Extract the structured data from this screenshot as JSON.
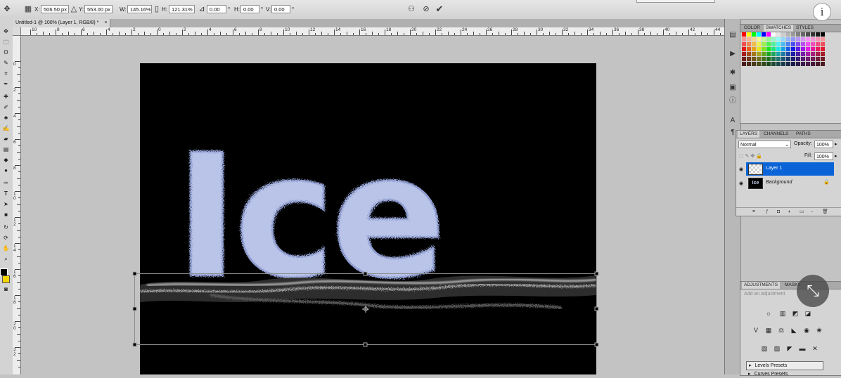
{
  "options_bar": {
    "x_label": "X:",
    "x_value": "506.50 px",
    "y_label": "Y:",
    "y_value": "553.00 px",
    "w_label": "W:",
    "w_value": "145.16%",
    "h_label": "H:",
    "h_value": "121.31%",
    "angle_value": "0.00",
    "hskew_label": "H:",
    "hskew_value": "0.00",
    "vskew_label": "V:",
    "vskew_value": "0.00",
    "degree_symbol": "°"
  },
  "document_tab": {
    "title": "Untitled-1 @ 100% (Layer 1, RGB/8) *",
    "close": "×"
  },
  "rulers": {
    "h_labels": [
      "10",
      "8",
      "6",
      "4",
      "2",
      "0",
      "2",
      "4",
      "6",
      "8",
      "10",
      "12",
      "14",
      "16",
      "18",
      "20",
      "22",
      "24",
      "26",
      "28",
      "30",
      "32",
      "34",
      "36",
      "38",
      "40",
      "42",
      "44"
    ],
    "v_labels": [
      "0",
      "2",
      "4",
      "6",
      "8",
      "10",
      "12",
      "14",
      "16",
      "18",
      "20",
      "22"
    ]
  },
  "canvas_text": "Ice",
  "color_panel": {
    "tabs": [
      "COLOR",
      "SWATCHES",
      "STYLES"
    ],
    "active_tab": "SWATCHES"
  },
  "layers_panel": {
    "tabs": [
      "LAYERS",
      "CHANNELS",
      "PATHS"
    ],
    "blend_mode": "Normal",
    "opacity_label": "Opacity:",
    "opacity_value": "100%",
    "fill_label": "Fill:",
    "fill_value": "100%",
    "layers": [
      {
        "name": "Layer 1",
        "selected": true
      },
      {
        "name": "Background",
        "selected": false,
        "thumb_text": "Ice"
      }
    ]
  },
  "adjustments_panel": {
    "tabs": [
      "ADJUSTMENTS",
      "MASKS"
    ],
    "hint": "Add an adjustment",
    "presets": [
      "Levels Presets",
      "Curves Presets"
    ]
  },
  "colors": {
    "accent": "#0a64d8",
    "letters": "#b9c4e8",
    "canvas": "#000000"
  }
}
